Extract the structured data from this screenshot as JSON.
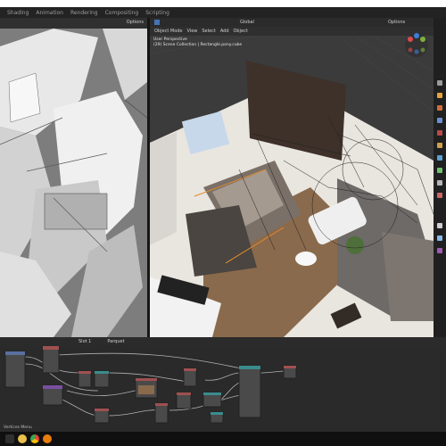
{
  "menu": {
    "items": [
      "Shading",
      "Animation",
      "Rendering",
      "Compositing",
      "Scripting"
    ]
  },
  "left_viewport": {
    "options_label": "Options"
  },
  "right_viewport": {
    "mode": "Object Mode",
    "menus": [
      "View",
      "Select",
      "Add",
      "Object"
    ],
    "transform": "Global",
    "options_label": "Options",
    "info_line1": "User Perspective",
    "info_line2": "(29) Scene Collection | Rectangle.pony.cube"
  },
  "node_editor": {
    "slot": "Slot 1",
    "material": "Parquet"
  },
  "status": {
    "label": "Vertices Menu"
  },
  "colors": {
    "viewport_bg": "#3d3d3d",
    "panel_bg": "#2a2a2a",
    "node_header_blue": "#5a6fa0",
    "node_header_red": "#a05050",
    "node_header_teal": "#3b8c8c",
    "link": "#a0a0a0"
  }
}
